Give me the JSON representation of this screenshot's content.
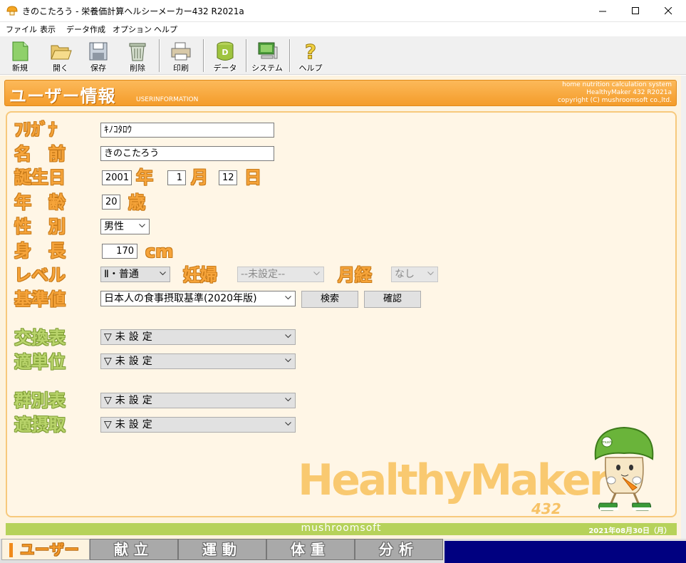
{
  "window": {
    "title": "きのこたろう - 栄養価計算ヘルシーメーカー432 R2021a",
    "minimize": "—",
    "maximize": "☐",
    "close": "✕"
  },
  "menu": [
    "ファイル",
    "表示",
    "データ作成",
    "オプション",
    "ヘルプ"
  ],
  "toolbar": [
    {
      "label": "新規",
      "icon": "new-document-icon"
    },
    {
      "label": "開く",
      "icon": "folder-open-icon"
    },
    {
      "label": "保存",
      "icon": "floppy-save-icon"
    },
    {
      "label": "削除",
      "icon": "trash-icon"
    },
    {
      "label": "印刷",
      "icon": "printer-icon"
    },
    {
      "label": "データ",
      "icon": "database-icon"
    },
    {
      "label": "システム",
      "icon": "computer-icon"
    },
    {
      "label": "ヘルプ",
      "icon": "help-icon"
    }
  ],
  "header": {
    "title": "ユーザー情報",
    "subtitle": "USERINFORMATION",
    "right_lines": [
      "home nutrition calculation system",
      "HealthyMaker 432 R2021a",
      "copyright (C) mushroomsoft co.,ltd."
    ]
  },
  "form": {
    "furigana": {
      "label": "ﾌﾘｶﾞﾅ",
      "value": "ｷﾉｺﾀﾛｳ"
    },
    "name": {
      "label": "名　前",
      "value": "きのこたろう"
    },
    "birthday": {
      "label": "誕生日",
      "year": "2001",
      "year_unit": "年",
      "month": "1",
      "month_unit": "月",
      "day": "12",
      "day_unit": "日"
    },
    "age": {
      "label": "年　齢",
      "value": "20",
      "unit": "歳"
    },
    "sex": {
      "label": "性　別",
      "value": "男性"
    },
    "height": {
      "label": "身　長",
      "value": "170",
      "unit": "cm"
    },
    "level": {
      "label": "レベル",
      "value": "Ⅱ・普通"
    },
    "pregnancy": {
      "label": "妊婦",
      "value": "--未設定--"
    },
    "menses": {
      "label": "月経",
      "value": "なし"
    },
    "standard": {
      "label": "基準値",
      "value": "日本人の食事摂取基準(2020年版)",
      "search_button": "検索",
      "confirm_button": "確認"
    },
    "exchange_table": {
      "label": "交換表",
      "value": "▽未設定"
    },
    "exchange_unit": {
      "label": "適単位",
      "value": "▽未設定"
    },
    "group_table": {
      "label": "群別表",
      "value": "▽未設定"
    },
    "group_intake": {
      "label": "適摂取",
      "value": "▽未設定"
    }
  },
  "logo": {
    "text": "HealthyMaker",
    "number": "432",
    "mascot_badge": "mush"
  },
  "status": {
    "center": "mushroomsoft",
    "date": "2021年08月30日（月）"
  },
  "tabs": [
    {
      "label": "ユーザー",
      "active": true
    },
    {
      "label": "献立",
      "active": false
    },
    {
      "label": "運動",
      "active": false
    },
    {
      "label": "体重",
      "active": false
    },
    {
      "label": "分析",
      "active": false
    }
  ],
  "colors": {
    "accent": "#f6a43a",
    "green": "#b6d25a",
    "panel": "#fdf3df",
    "tabfill": "#000080"
  }
}
